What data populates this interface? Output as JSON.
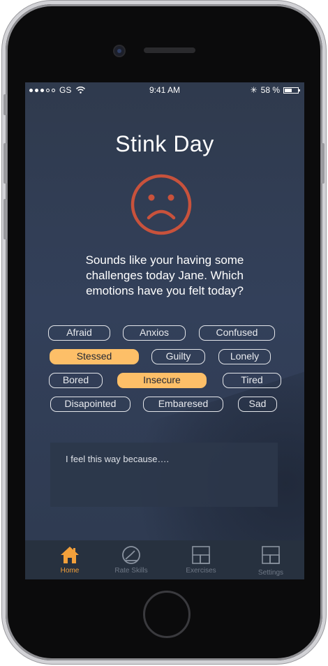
{
  "status_bar": {
    "carrier": "GS",
    "time": "9:41 AM",
    "bluetooth": "✳",
    "battery_percent": "58 %",
    "battery_level": 0.58
  },
  "screen": {
    "title": "Stink Day",
    "mood_icon": "sad-face-icon",
    "message": "Sounds like your having some challenges today Jane. Which emotions have you felt today?",
    "emotions": [
      {
        "label": "Afraid",
        "selected": false
      },
      {
        "label": "Anxios",
        "selected": false
      },
      {
        "label": "Confused",
        "selected": false
      },
      {
        "label": "Stessed",
        "selected": true
      },
      {
        "label": "Guilty",
        "selected": false
      },
      {
        "label": "Lonely",
        "selected": false
      },
      {
        "label": "Bored",
        "selected": false
      },
      {
        "label": "Insecure",
        "selected": true
      },
      {
        "label": "Tired",
        "selected": false
      },
      {
        "label": "Disapointed",
        "selected": false
      },
      {
        "label": "Embaresed",
        "selected": false
      },
      {
        "label": "Sad",
        "selected": false
      }
    ],
    "reason_placeholder": "I feel this way because…."
  },
  "tab_bar": {
    "tabs": [
      {
        "label": "Home",
        "icon": "home-icon",
        "active": true
      },
      {
        "label": "Rate Skills",
        "icon": "clock-icon",
        "active": false
      },
      {
        "label": "Exercises",
        "icon": "panels-icon",
        "active": false
      },
      {
        "label": "Settings",
        "icon": "panels-icon",
        "active": false
      }
    ]
  },
  "colors": {
    "accent": "#fdbf68",
    "active_tab": "#f2a03b",
    "sad_face": "#c8523c",
    "background": "#2f3a4d"
  }
}
